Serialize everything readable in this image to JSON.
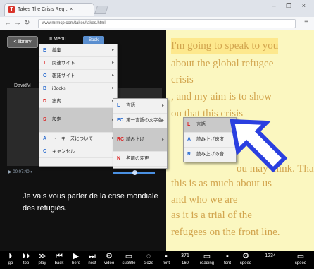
{
  "browser": {
    "tab_title": "Takes The Crisis Req... ×",
    "url": "www.mrmcp.com/takes/takes.html",
    "window_controls": "– ❐ ×"
  },
  "player": {
    "library_label": "< library",
    "menu_label": "≡ Menu",
    "top_label": "Book",
    "speaker_name": "DavidM",
    "time": "▶ 00:07:40 ⏸",
    "subtitle_text": "Je vais vous parler de la crise mondiale des réfugiés."
  },
  "text_pane": {
    "lines": [
      "I'm going to speak to you",
      "about the global refugee",
      "crisis",
      ", and my aim is to show",
      "ou that this crisis",
      "",
      "",
      "ou may think. That",
      "this is as much about us",
      "and who we are",
      "as it is a trial of the",
      "refugees on the front line."
    ]
  },
  "menus": {
    "main": [
      {
        "key": "E",
        "label": "編集",
        "color": "#2f6fd0"
      },
      {
        "key": "T",
        "label": "関連サイト",
        "color": "#d22"
      },
      {
        "key": "O",
        "label": "雑誌サイト",
        "color": "#2f6fd0"
      },
      {
        "key": "B",
        "label": "iBooks",
        "color": "#2f6fd0"
      },
      {
        "key": "D",
        "label": "案内",
        "color": "#d22"
      },
      {
        "key": "S",
        "label": "設定",
        "color": "#d22"
      },
      {
        "key": "A",
        "label": "トーキーズについて",
        "color": "#2f6fd0"
      },
      {
        "key": "C",
        "label": "キャンセル",
        "color": "#2f6fd0"
      }
    ],
    "settings": [
      {
        "key": "L",
        "label": "言語",
        "color": "#2f6fd0"
      },
      {
        "key": "FC",
        "label": "第一言語の文字色",
        "color": "#2f6fd0"
      },
      {
        "key": "RC",
        "label": "読み上げ",
        "color": "#d22"
      },
      {
        "key": "N",
        "label": "名前の変更",
        "color": "#d22"
      }
    ],
    "voice": [
      {
        "key": "L",
        "label": "言語",
        "color": "#d22"
      },
      {
        "key": "A",
        "label": "読み上げ速度",
        "color": "#2f6fd0"
      },
      {
        "key": "R",
        "label": "読み上げの音",
        "color": "#2f6fd0"
      }
    ]
  },
  "toolbar": {
    "buttons": [
      {
        "icon": "⏵",
        "label": "go",
        "name": "go-icon"
      },
      {
        "icon": "⏵⏵",
        "label": "top",
        "name": "top-icon"
      },
      {
        "icon": "≫",
        "label": "play",
        "name": "play-icon"
      },
      {
        "icon": "⏮",
        "label": "back",
        "name": "back-icon"
      },
      {
        "icon": "▶",
        "label": "here",
        "name": "here-icon"
      },
      {
        "icon": "⏭",
        "label": "next",
        "name": "next-icon"
      },
      {
        "icon": "⚙",
        "label": "video",
        "name": "video-icon"
      },
      {
        "icon": "▭",
        "label": "subtitle",
        "name": "subtitle-icon"
      },
      {
        "icon": "◌",
        "label": "cloze",
        "name": "cloze-icon"
      },
      {
        "icon": "▪",
        "label": "font",
        "name": "font-icon"
      },
      {
        "icon": "371",
        "label": "160",
        "name": "counter-icon"
      },
      {
        "icon": "▭",
        "label": "reading",
        "name": "reading-icon"
      },
      {
        "icon": "▪",
        "label": "font",
        "name": "font2-icon"
      },
      {
        "icon": "⚙",
        "label": "speed",
        "name": "speed-icon"
      },
      {
        "icon": "1234",
        "label": "",
        "name": "numbers-icon"
      },
      {
        "icon": "▭",
        "label": "speed",
        "name": "speed2-icon"
      }
    ]
  }
}
